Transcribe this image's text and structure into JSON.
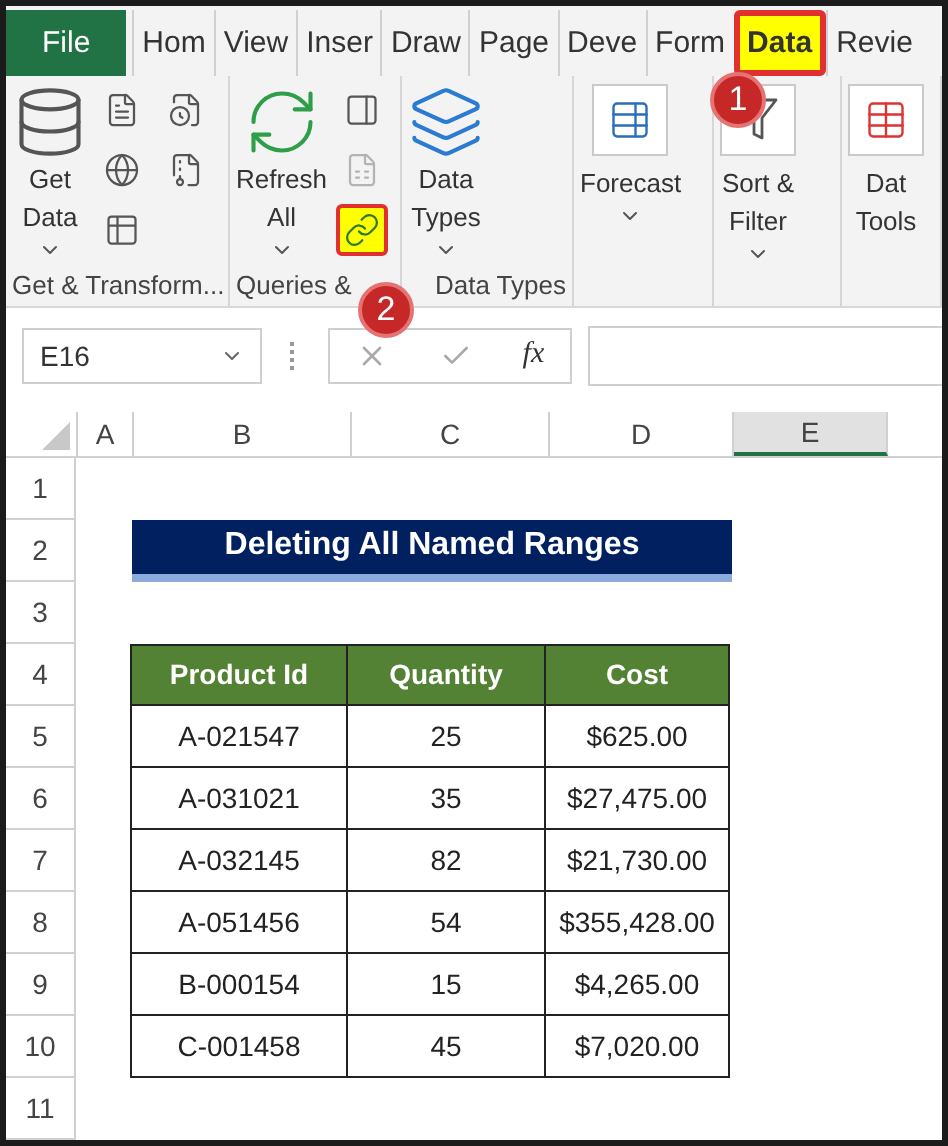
{
  "tabs": [
    {
      "label": "File",
      "kind": "file",
      "selected": false,
      "highlighted": false
    },
    {
      "label": "Hom",
      "kind": "tab",
      "selected": false,
      "highlighted": false
    },
    {
      "label": "View",
      "kind": "tab",
      "selected": false,
      "highlighted": false
    },
    {
      "label": "Inser",
      "kind": "tab",
      "selected": false,
      "highlighted": false
    },
    {
      "label": "Draw",
      "kind": "tab",
      "selected": false,
      "highlighted": false
    },
    {
      "label": "Page",
      "kind": "tab",
      "selected": false,
      "highlighted": false
    },
    {
      "label": "Deve",
      "kind": "tab",
      "selected": false,
      "highlighted": false
    },
    {
      "label": "Form",
      "kind": "tab",
      "selected": false,
      "highlighted": false
    },
    {
      "label": "Data",
      "kind": "tab",
      "selected": true,
      "highlighted": true
    },
    {
      "label": "Revie",
      "kind": "tab",
      "selected": false,
      "highlighted": false
    }
  ],
  "ribbon": {
    "groups": [
      {
        "label": "Get & Transform...",
        "commands": [
          {
            "kind": "large",
            "label": [
              "Get",
              "Data"
            ],
            "dropdown": true
          },
          {
            "kind": "tools",
            "items": [
              {
                "disabled": false,
                "highlighted": false
              },
              {
                "disabled": false,
                "highlighted": false
              },
              {
                "disabled": false,
                "highlighted": false
              },
              {
                "disabled": false,
                "highlighted": false
              },
              {
                "disabled": false,
                "highlighted": false
              }
            ]
          }
        ]
      },
      {
        "label": "Queries &",
        "commands": [
          {
            "kind": "large",
            "label": [
              "Refresh",
              "All"
            ],
            "dropdown": true
          },
          {
            "kind": "tools",
            "items": [
              {
                "disabled": false,
                "highlighted": false
              },
              {
                "disabled": true,
                "highlighted": false
              },
              {
                "disabled": false,
                "highlighted": true
              }
            ]
          }
        ]
      },
      {
        "label": "Data Types",
        "commands": [
          {
            "kind": "large",
            "label": [
              "Data",
              "Types"
            ],
            "dropdown": true
          }
        ]
      },
      {
        "commands": [
          {
            "kind": "boxed",
            "label": [
              "Forecast"
            ],
            "dropdown": true
          }
        ]
      },
      {
        "commands": [
          {
            "kind": "boxed",
            "label": [
              "Sort &",
              "Filter"
            ],
            "dropdown": true
          }
        ]
      },
      {
        "commands": [
          {
            "kind": "boxed",
            "label": [
              "Dat",
              "Tools"
            ],
            "dropdown": false
          }
        ]
      }
    ]
  },
  "callouts": [
    {
      "number": "1"
    },
    {
      "number": "2"
    }
  ],
  "formula_bar": {
    "name_box": "E16",
    "function_label": "fx"
  },
  "columns": [
    {
      "label": "A",
      "selected": false
    },
    {
      "label": "B",
      "selected": false
    },
    {
      "label": "C",
      "selected": false
    },
    {
      "label": "D",
      "selected": false
    },
    {
      "label": "E",
      "selected": true
    }
  ],
  "row_numbers": [
    "1",
    "2",
    "3",
    "4",
    "5",
    "6",
    "7",
    "8",
    "9",
    "10",
    "11"
  ],
  "sheet": {
    "title": "Deleting All Named Ranges",
    "table": {
      "columns": [
        "Product Id",
        "Quantity",
        "Cost"
      ],
      "rows": [
        [
          "A-021547",
          "25",
          "$625.00"
        ],
        [
          "A-031021",
          "35",
          "$27,475.00"
        ],
        [
          "A-032145",
          "82",
          "$21,730.00"
        ],
        [
          "A-051456",
          "54",
          "$355,428.00"
        ],
        [
          "B-000154",
          "15",
          "$4,265.00"
        ],
        [
          "C-001458",
          "45",
          "$7,020.00"
        ]
      ]
    }
  }
}
